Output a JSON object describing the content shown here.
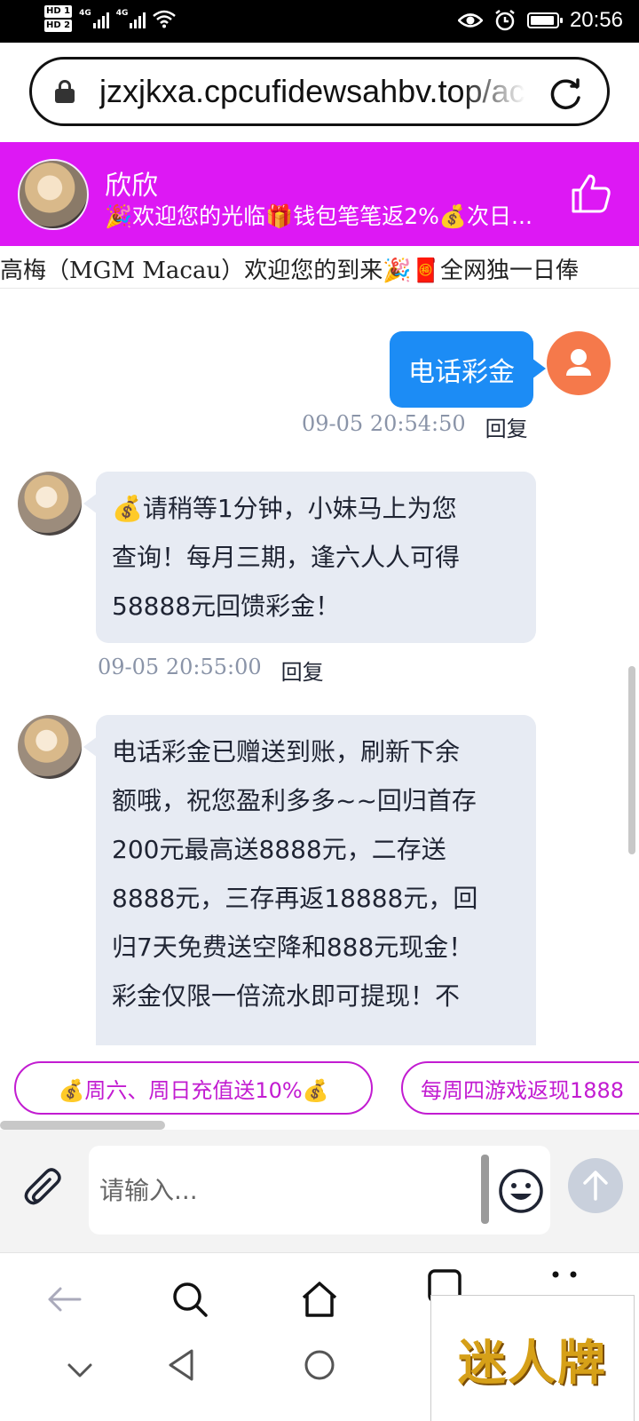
{
  "status_bar": {
    "time": "20:56",
    "sim1": "HD 1",
    "sim2": "HD 2",
    "net1": "4G",
    "net2": "4G"
  },
  "browser": {
    "url": "jzxjkxa.cpcufidewsahbv.top/ac"
  },
  "chat_header": {
    "agent_name": "欣欣",
    "welcome": "🎉欢迎您的光临🎁钱包笔笔返2%💰次日..."
  },
  "marquee": {
    "text": "高梅（MGM Macau）欢迎您的到来🎉🧧全网独一日俸"
  },
  "messages": [
    {
      "from": "user",
      "text": "电话彩金",
      "time": "09-05 20:54:50",
      "reply": "回复"
    },
    {
      "from": "agent",
      "lines": [
        "💰请稍等1分钟，小妹马上为您",
        "查询！每月三期，逢六人人可得",
        "58888元回馈彩金！"
      ],
      "time": "09-05 20:55:00",
      "reply": "回复"
    },
    {
      "from": "agent",
      "lines": [
        "电话彩金已赠送到账，刷新下余",
        "额哦，祝您盈利多多~~回归首存",
        "200元最高送8888元，二存送",
        "8888元，三存再返18888元，回",
        "归7天免费送空降和888元现金！",
        "彩金仅限一倍流水即可提现！不"
      ]
    }
  ],
  "quick_replies": [
    "💰周六、周日充值送10%💰",
    "每周四游戏返现1888"
  ],
  "composer": {
    "placeholder": "请输入..."
  },
  "promo": {
    "text": "迷人牌"
  }
}
